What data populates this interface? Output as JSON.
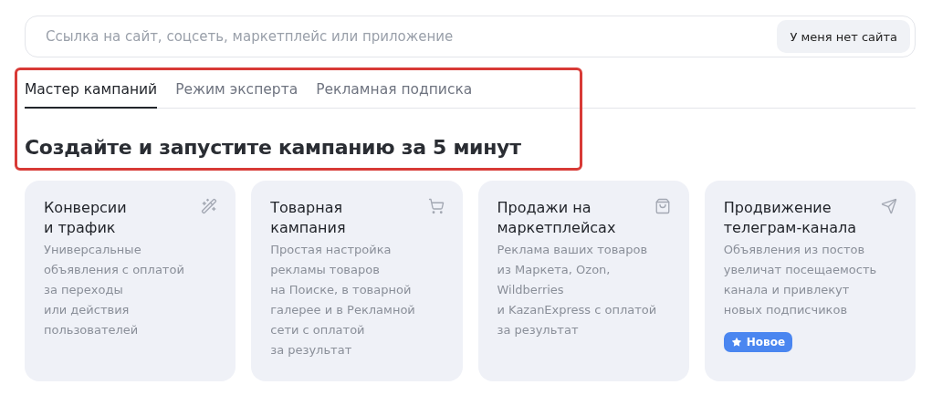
{
  "search": {
    "placeholder": "Ссылка на сайт, соцсеть, маркетплейс или приложение",
    "button": "У меня нет сайта"
  },
  "tabs": [
    {
      "label": "Мастер кампаний",
      "selected": true
    },
    {
      "label": "Режим эксперта",
      "selected": false
    },
    {
      "label": "Рекламная подписка",
      "selected": false
    }
  ],
  "heading": "Создайте и запустите кампанию за 5 минут",
  "cards": [
    {
      "title": "Конверсии\nи трафик",
      "description": "Универсальные\nобъявления с оплатой\nза переходы\nили действия\nпользователей"
    },
    {
      "title": "Товарная\nкампания",
      "description": "Простая настройка\nрекламы товаров\nна Поиске, в товарной\nгалерее и в Рекламной\nсети с оплатой\nза результат"
    },
    {
      "title": "Продажи на\nмаркетплейсах",
      "description": "Реклама ваших товаров\nиз Маркета, Ozon,\nWildberries\nи KazanExpress с оплатой\nза результат"
    },
    {
      "title": "Продвижение\nтелеграм-канала",
      "description": "Объявления из постов\nувеличат посещаемость\nканала и привлекут\nновых подписчиков",
      "badge": "Новое"
    }
  ]
}
